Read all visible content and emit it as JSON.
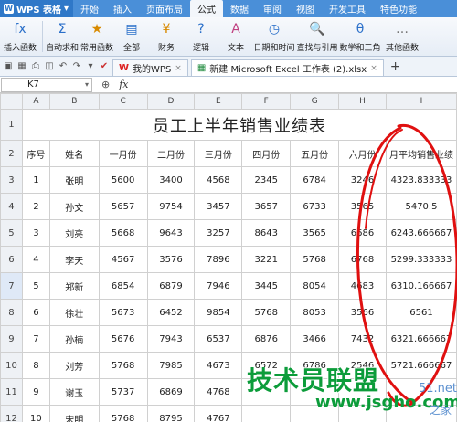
{
  "app": {
    "name": "WPS 表格"
  },
  "tabs": [
    "开始",
    "插入",
    "页面布局",
    "公式",
    "数据",
    "审阅",
    "视图",
    "开发工具",
    "特色功能"
  ],
  "active_tab": "公式",
  "ribbon": [
    {
      "label": "插入函数",
      "icon": "fx"
    },
    {
      "label": "自动求和",
      "icon": "Σ"
    },
    {
      "label": "常用函数",
      "icon": "★"
    },
    {
      "label": "全部",
      "icon": "▤"
    },
    {
      "label": "财务",
      "icon": "¥"
    },
    {
      "label": "逻辑",
      "icon": "?"
    },
    {
      "label": "文本",
      "icon": "A"
    },
    {
      "label": "日期和时间",
      "icon": "◷"
    },
    {
      "label": "查找与引用",
      "icon": "🔍"
    },
    {
      "label": "数学和三角",
      "icon": "θ"
    },
    {
      "label": "其他函数",
      "icon": "…"
    }
  ],
  "doc_tabs": [
    "我的WPS",
    "新建 Microsoft Excel 工作表 (2).xlsx"
  ],
  "name_box": "K7",
  "formula_symbol": "fx",
  "columns": [
    "A",
    "B",
    "C",
    "D",
    "E",
    "F",
    "G",
    "H",
    "I"
  ],
  "title": "员工上半年销售业绩表",
  "headers": [
    "序号",
    "姓名",
    "一月份",
    "二月份",
    "三月份",
    "四月份",
    "五月份",
    "六月份",
    "月平均销售业绩"
  ],
  "rows": [
    [
      "1",
      "张明",
      "5600",
      "3400",
      "4568",
      "2345",
      "6784",
      "3246",
      "4323.833333"
    ],
    [
      "2",
      "孙文",
      "5657",
      "9754",
      "3457",
      "3657",
      "6733",
      "3565",
      "5470.5"
    ],
    [
      "3",
      "刘亮",
      "5668",
      "9643",
      "3257",
      "8643",
      "3565",
      "6686",
      "6243.666667"
    ],
    [
      "4",
      "李天",
      "4567",
      "3576",
      "7896",
      "3221",
      "5768",
      "6768",
      "5299.333333"
    ],
    [
      "5",
      "郑新",
      "6854",
      "6879",
      "7946",
      "3445",
      "8054",
      "4683",
      "6310.166667"
    ],
    [
      "6",
      "徐壮",
      "5673",
      "6452",
      "9854",
      "5768",
      "8053",
      "3566",
      "6561"
    ],
    [
      "7",
      "孙楠",
      "5676",
      "7943",
      "6537",
      "6876",
      "3466",
      "7432",
      "6321.666667"
    ],
    [
      "8",
      "刘芳",
      "5768",
      "7985",
      "4673",
      "6572",
      "6786",
      "2546",
      "5721.666667"
    ],
    [
      "9",
      "谢玉",
      "5737",
      "6869",
      "4768",
      "",
      "",
      "",
      ""
    ],
    [
      "10",
      "宋明",
      "5768",
      "8795",
      "4767",
      "",
      "",
      "",
      ""
    ]
  ],
  "row_numbers": [
    "1",
    "2",
    "3",
    "4",
    "5",
    "6",
    "7",
    "8",
    "9",
    "10",
    "11",
    "12"
  ],
  "watermark": {
    "main": "技术员联盟",
    "url": "www.jsgho.com",
    "side1": "51.net",
    "side2": "之家"
  },
  "colors": {
    "title_bar": "#4a8fd8",
    "annotation": "#e01010",
    "watermark": "#0c9c3a"
  }
}
